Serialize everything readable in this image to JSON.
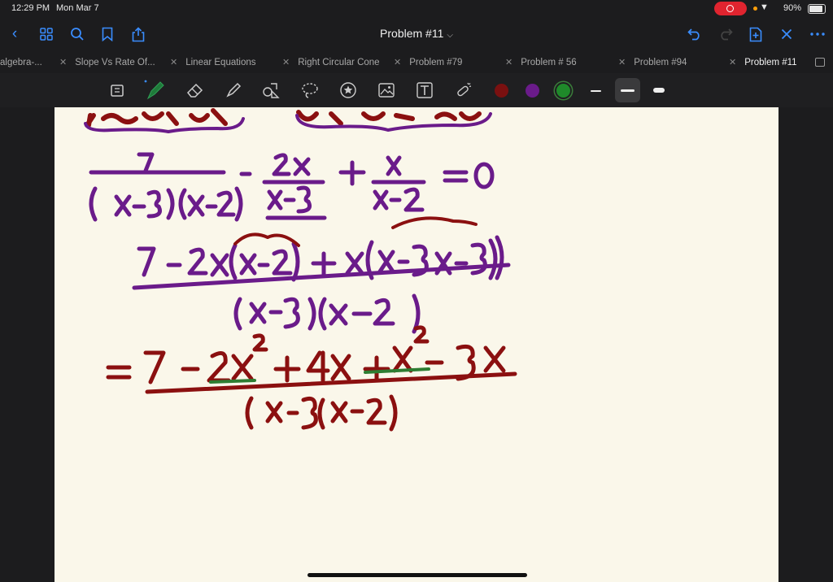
{
  "status": {
    "time": "12:29 PM",
    "date": "Mon Mar 7",
    "battery": "90%"
  },
  "nav": {
    "title": "Problem #11"
  },
  "tabs": [
    {
      "label": "algebra-..."
    },
    {
      "label": "Slope Vs Rate Of..."
    },
    {
      "label": "Linear Equations"
    },
    {
      "label": "Right Circular Cone"
    },
    {
      "label": "Problem #79"
    },
    {
      "label": "Problem # 56"
    },
    {
      "label": "Problem #94"
    },
    {
      "label": "Problem #11"
    }
  ],
  "colors": {
    "accent": "#3a8dff",
    "ink_purple": "#6a1b8a",
    "ink_red": "#8b1010",
    "ink_green": "#2e7d32",
    "paper": "#faf7ea"
  },
  "icons": [
    "back-icon",
    "grid-icon",
    "search-icon",
    "bookmark-icon",
    "share-icon",
    "undo-icon",
    "redo-icon",
    "add-page-icon",
    "close-icon",
    "more-icon"
  ]
}
